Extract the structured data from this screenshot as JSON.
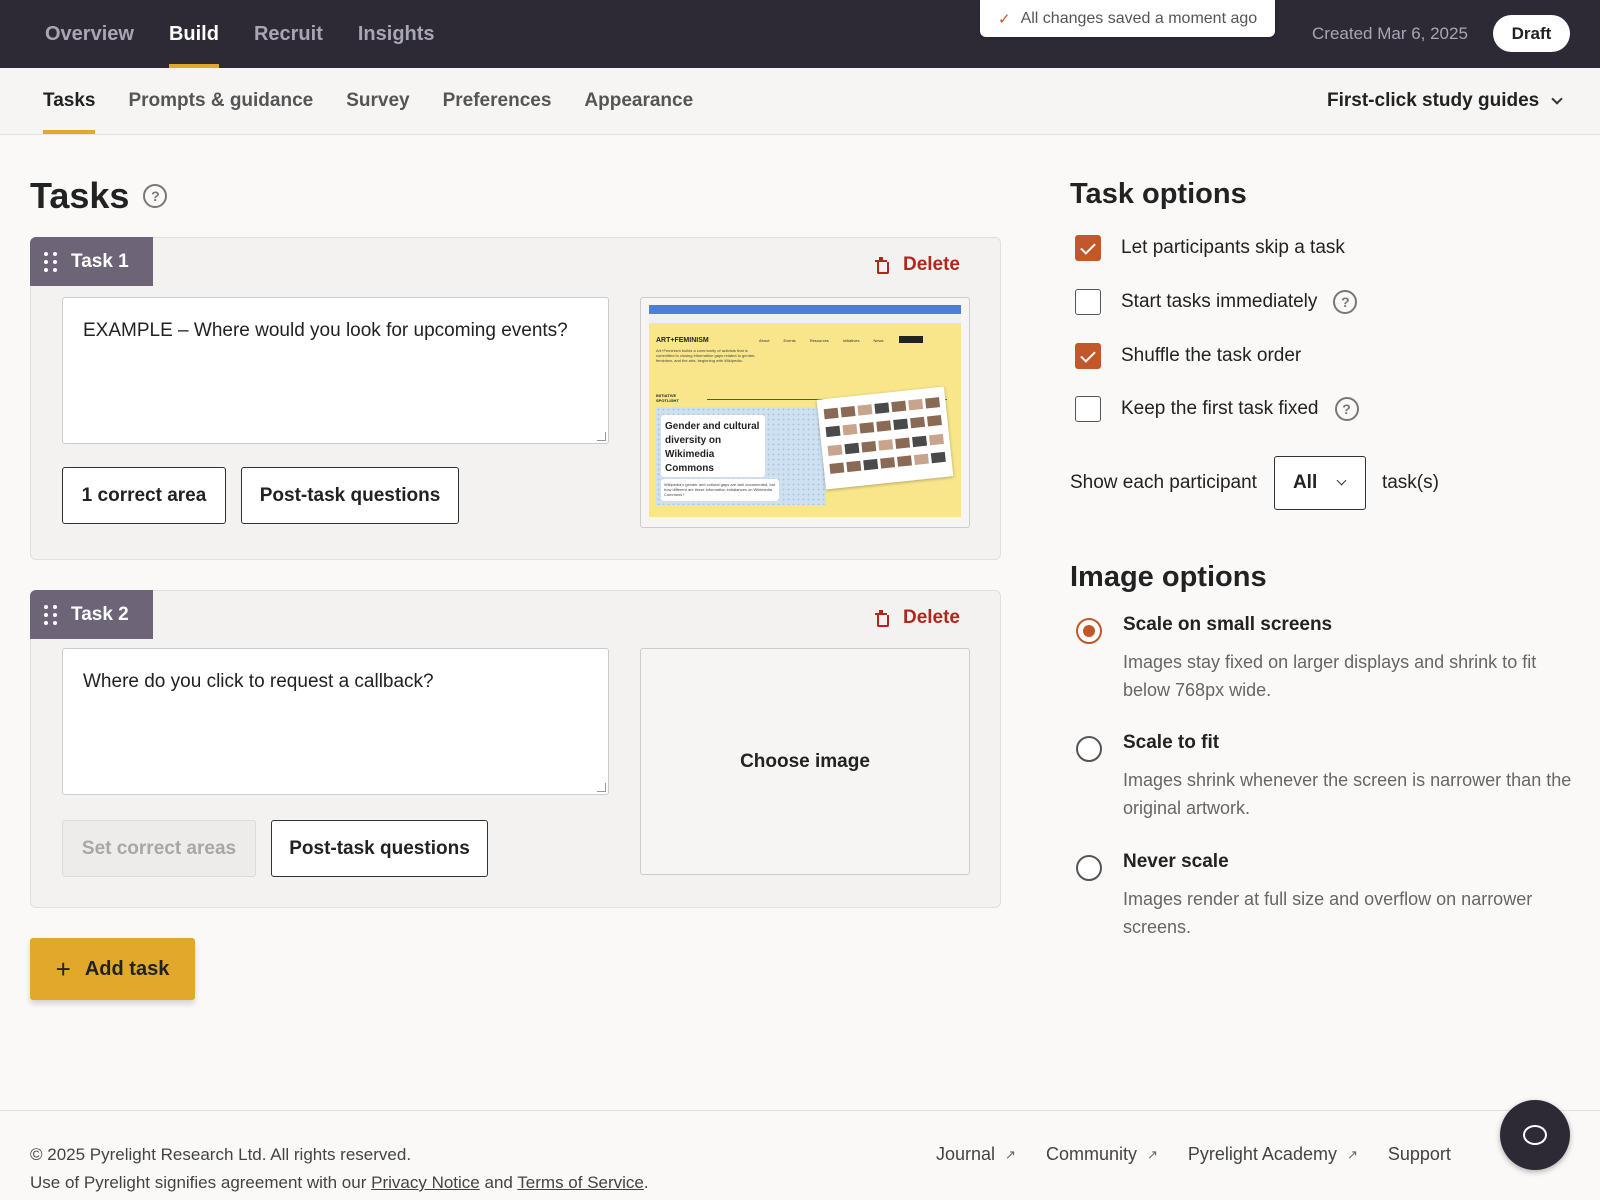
{
  "topnav": {
    "items": [
      "Overview",
      "Build",
      "Recruit",
      "Insights"
    ],
    "active": "Build",
    "saved_message": "All changes saved a moment ago",
    "created": "Created Mar 6, 2025",
    "status": "Draft"
  },
  "subnav": {
    "tabs": [
      "Tasks",
      "Prompts & guidance",
      "Survey",
      "Preferences",
      "Appearance"
    ],
    "active": "Tasks",
    "guides": "First-click study guides"
  },
  "tasks_section": {
    "title": "Tasks",
    "tasks": [
      {
        "label": "Task 1",
        "delete_label": "Delete",
        "question": "EXAMPLE – Where would you look for upcoming events?",
        "areas_button": "1 correct area",
        "areas_disabled": false,
        "post_task_button": "Post-task questions",
        "has_image": true
      },
      {
        "label": "Task 2",
        "delete_label": "Delete",
        "question": "Where do you click to request a callback?",
        "areas_button": "Set correct areas",
        "areas_disabled": true,
        "post_task_button": "Post-task questions",
        "has_image": false,
        "choose_image_label": "Choose image"
      }
    ],
    "add_task_label": "Add task"
  },
  "thumbnail": {
    "logo": "ART+FEMINISM",
    "menu": [
      "About",
      "Events",
      "Resources",
      "Initiatives",
      "News"
    ],
    "blurb": "Art+Feminism builds a community of activists that is committed to closing information gaps related to gender, feminism, and the arts, beginning with Wikipedia.",
    "spotlight": "INITIATIVE SPOTLIGHT",
    "card_title": "Gender and cultural diversity on Wikimedia Commons",
    "card_sub": "Wikipedia's gender and cultural gaps are well documented, but how different are these information imbalances on Wikimedia Commons?"
  },
  "task_options": {
    "title": "Task options",
    "options": [
      {
        "label": "Let participants skip a task",
        "checked": true,
        "help": false
      },
      {
        "label": "Start tasks immediately",
        "checked": false,
        "help": true
      },
      {
        "label": "Shuffle the task order",
        "checked": true,
        "help": false
      },
      {
        "label": "Keep the first task fixed",
        "checked": false,
        "help": true
      }
    ],
    "show_each_label": "Show each participant",
    "show_each_value": "All",
    "show_each_suffix": "task(s)"
  },
  "image_options": {
    "title": "Image options",
    "options": [
      {
        "title": "Scale on small screens",
        "desc": "Images stay fixed on larger displays and shrink to fit below 768px wide.",
        "selected": true
      },
      {
        "title": "Scale to fit",
        "desc": "Images shrink whenever the screen is narrower than the original artwork.",
        "selected": false
      },
      {
        "title": "Never scale",
        "desc": "Images render at full size and overflow on narrower screens.",
        "selected": false
      }
    ]
  },
  "footer": {
    "copyright": "© 2025 Pyrelight Research Ltd. All rights reserved.",
    "terms_prefix": "Use of Pyrelight signifies agreement with our",
    "privacy": "Privacy Notice",
    "and": "and",
    "tos": "Terms of Service",
    "links": [
      "Journal",
      "Community",
      "Pyrelight Academy",
      "Support"
    ]
  },
  "colors": {
    "topbar": "#2d2a36",
    "accent": "#e1a82c",
    "check": "#c2572a",
    "delete": "#b3261e",
    "task_tab": "#6d6478"
  }
}
